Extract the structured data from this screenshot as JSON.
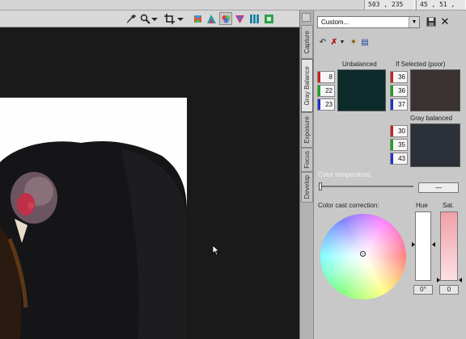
{
  "status_bar": {
    "position_readout": "503 , 235",
    "rgb_readout": "45 , 51 , 60"
  },
  "toolbar": {
    "tools": [
      {
        "name": "eyedropper-tool",
        "icon": "eyedropper-icon"
      },
      {
        "name": "zoom-tool",
        "icon": "magnifier-icon"
      },
      {
        "name": "zoom-dropdown",
        "icon": "chevron-down-icon"
      },
      {
        "name": "crop-tool",
        "icon": "crop-icon"
      },
      {
        "name": "crop-dropdown",
        "icon": "chevron-down-icon"
      },
      {
        "name": "tool-a",
        "icon": "color-cube-icon"
      },
      {
        "name": "tool-b",
        "icon": "color-cube-icon"
      },
      {
        "name": "tool-c",
        "icon": "color-balance-icon"
      },
      {
        "name": "tool-d",
        "icon": "color-balance-icon"
      },
      {
        "name": "tool-e",
        "icon": "grid-icon"
      },
      {
        "name": "tool-f",
        "icon": "fit-icon"
      }
    ]
  },
  "side_tabs": [
    "Capture",
    "Gray Balance",
    "Exposure",
    "Focus",
    "Develop"
  ],
  "active_tab": "Gray Balance",
  "panel": {
    "preset": "Custom...",
    "unbalanced_label": "Unbalanced",
    "if_selected_label": "If Selected (poor)",
    "gray_balanced_label": "Gray balanced",
    "unbalanced_values": [
      "8",
      "22",
      "23"
    ],
    "if_selected_values": [
      "36",
      "36",
      "37"
    ],
    "gray_balanced_values": [
      "30",
      "35",
      "43"
    ],
    "unbalanced_color": "#0d2a2a",
    "if_selected_color": "#3a3230",
    "gray_balanced_color": "#2c3038",
    "color_temperature_label": "Color temperature:",
    "color_temperature_value": "—",
    "color_cast_label": "Color cast correction:",
    "hue_label": "Hue",
    "sat_label": "Sat.",
    "hue_value": "0°",
    "sat_value": "0"
  },
  "colors": {
    "channel_red": "#cc2020",
    "channel_green": "#22a022",
    "channel_blue": "#2030cc"
  }
}
